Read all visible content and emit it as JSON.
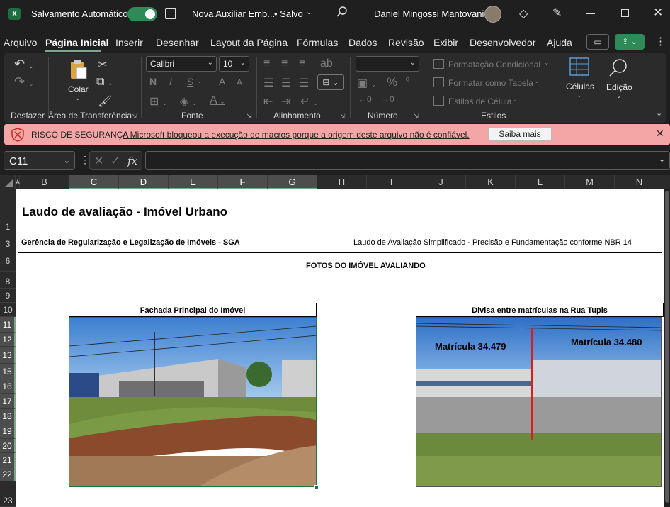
{
  "titlebar": {
    "autosave_label": "Salvamento Automático",
    "doc_name": "Nova Auxiliar Emb...",
    "save_status": "• Salvo",
    "user_name": "Daniel Mingossi Mantovani"
  },
  "menu": {
    "items": [
      "Arquivo",
      "Página Inicial",
      "Inserir",
      "Desenhar",
      "Layout da Página",
      "Fórmulas",
      "Dados",
      "Revisão",
      "Exibir",
      "Desenvolvedor",
      "Ajuda"
    ]
  },
  "ribbon": {
    "paste_label": "Colar",
    "font_name": "Calibri",
    "font_size": "10",
    "bold": "N",
    "italic": "I",
    "underline": "S",
    "grow_font": "A",
    "shrink_font": "A",
    "conditional_format": "Formatação Condicional",
    "format_table": "Formatar como Tabela",
    "cell_styles": "Estilos de Célula",
    "cells_label": "Células",
    "edit_label": "Edição",
    "groups": {
      "undo": "Desfazer",
      "clipboard": "Área de Transferência",
      "font": "Fonte",
      "alignment": "Alinhamento",
      "number": "Número",
      "styles": "Estilos"
    }
  },
  "security": {
    "title": "RISCO DE SEGURANÇA",
    "message": "A Microsoft bloqueou a execução de macros porque a origem deste arquivo não é confiável.",
    "button": "Saiba mais"
  },
  "formula": {
    "name_box": "C11",
    "fx": "fx",
    "value": ""
  },
  "grid": {
    "columns": [
      "A",
      "B",
      "C",
      "D",
      "E",
      "F",
      "G",
      "H",
      "I",
      "J",
      "K",
      "L",
      "M",
      "N"
    ],
    "rows": [
      "1",
      "3",
      "6",
      "8",
      "9",
      "10",
      "11",
      "12",
      "13",
      "15",
      "16",
      "17",
      "18",
      "19",
      "20",
      "21",
      "22",
      "23"
    ],
    "title": "Laudo de avaliação - Imóvel Urbano",
    "dept": "Gerência de Regularização e Legalização de Imóveis - SGA",
    "report_type": "Laudo de Avaliação Simplificado - Precisão e Fundamentação conforme NBR 14",
    "section": "FOTOS DO IMÓVEL AVALIANDO",
    "photo1_caption": "Fachada Principal do Imóvel",
    "photo2_caption": "Divisa entre matrículas na Rua Tupis",
    "photo2_left_label": "Matrícula 34.479",
    "photo2_right_label": "Matrícula 34.480"
  }
}
